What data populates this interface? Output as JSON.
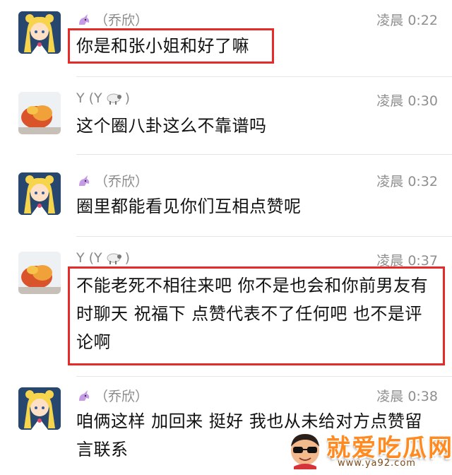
{
  "messages": [
    {
      "name": "（乔欣）",
      "time": "凌晨 0:22",
      "text": "你是和张小姐和好了嘛"
    },
    {
      "name": "Y (Y",
      "time": "凌晨 0:30",
      "text": "这个圈八卦这么不靠谱吗"
    },
    {
      "name": "（乔欣）",
      "time": "凌晨 0:32",
      "text": "圈里都能看见你们互相点赞呢"
    },
    {
      "name": "Y (Y",
      "time": "凌晨 0:37",
      "text": "不能老死不相往来吧 你不是也会和你前男友有时聊天 祝福下 点赞代表不了任何吧 也不是评论啊"
    },
    {
      "name": "（乔欣）",
      "time": "凌晨 0:38",
      "text": "咱俩这样 加回来 挺好 我也从未给对方点赞留言联系"
    }
  ],
  "watermark": {
    "title": "就爱吃瓜网",
    "url": "www.ya92.com"
  },
  "colors": {
    "highlight": "#e52a2a",
    "meta_text": "#8a8a8a",
    "watermark": "#ff8a1f"
  }
}
